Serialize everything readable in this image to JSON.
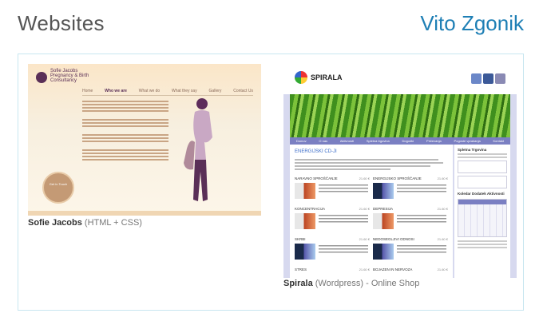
{
  "header": {
    "title": "Websites",
    "author": "Vito Zgonik"
  },
  "sites": [
    {
      "name": "Sofie Jacobs",
      "tech": "(HTML + CSS)",
      "brand": "Sofie Jacobs",
      "brand_sub": "Pregnancy & Birth Consultancy",
      "nav": [
        "Home",
        "Who we are",
        "What we do",
        "What they say",
        "Gallery",
        "Contact Us"
      ],
      "badge": "Get in Touch"
    },
    {
      "name": "Spirala",
      "tech": "(Wordpress) - Online Shop",
      "logo_text": "SPIRALA",
      "nav": [
        "Domov",
        "O nas",
        "Aktivnosti",
        "Spletna trgovina",
        "Dogodki",
        "Pričevanja",
        "Pogoste vprašanja",
        "Kontakt"
      ],
      "section_title": "ENERGIJSKI CD-JI",
      "products": [
        {
          "title": "NARAVNO SPROŠČANJE",
          "price": "21.60 €"
        },
        {
          "title": "ENERGIJSKO SPROŠČANJE",
          "price": "21.60 €"
        },
        {
          "title": "KONCENTRACIJA",
          "price": "21.60 €"
        },
        {
          "title": "DEPRESIJA",
          "price": "21.60 €"
        },
        {
          "title": "SKRBI",
          "price": "21.60 €"
        },
        {
          "title": "NEDOSEGLJIVI ODNOSI",
          "price": "21.60 €"
        },
        {
          "title": "STRES",
          "price": "21.60 €"
        },
        {
          "title": "BOJAZEN IN NERVOZA",
          "price": "21.60 €"
        }
      ],
      "sidebar": {
        "cart": "Spletna Trgovina",
        "calendar": "Koledar Dodatek Aktivnosti"
      }
    }
  ]
}
